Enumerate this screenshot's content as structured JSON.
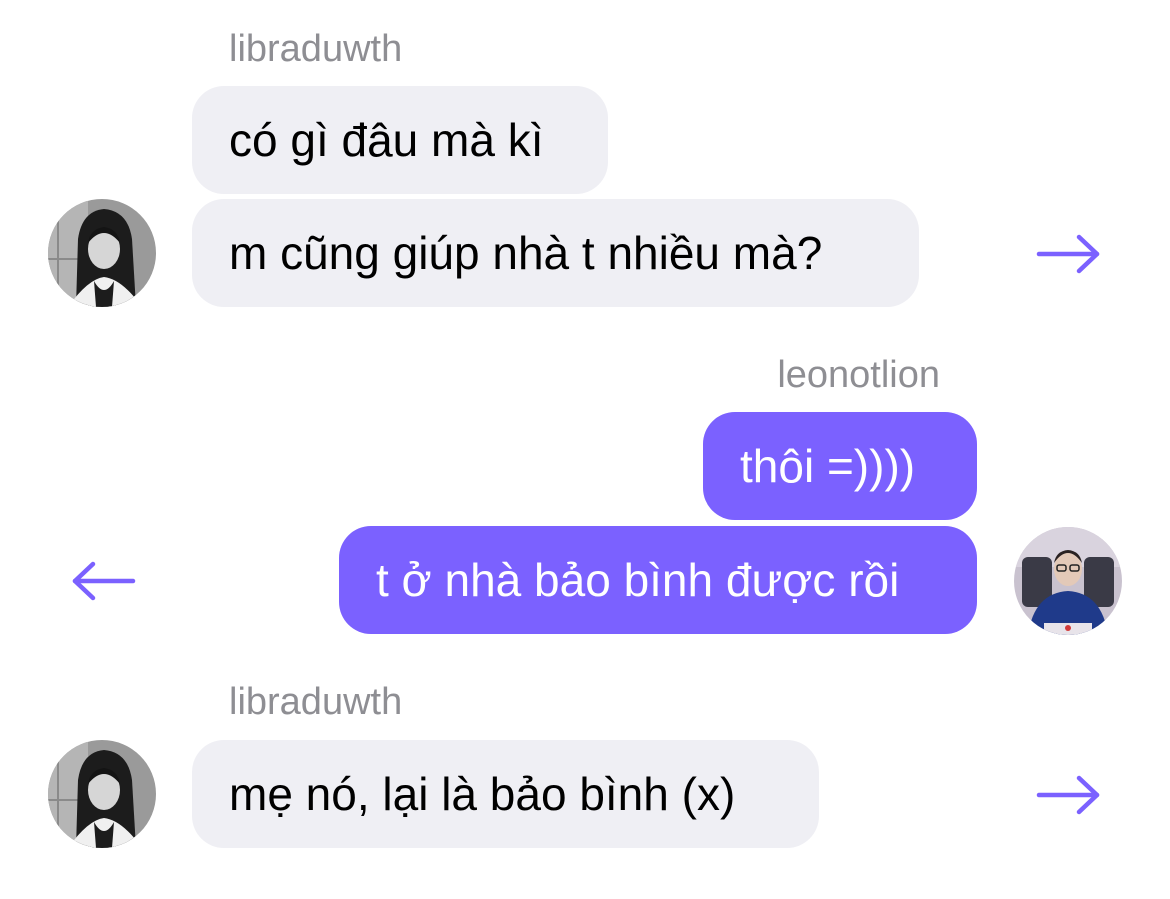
{
  "colors": {
    "incoming_bubble": "#efeff4",
    "outgoing_bubble": "#7b61ff",
    "sender_name": "#8e8e93",
    "action_arrow": "#7b61ff"
  },
  "messages": [
    {
      "sender": "libraduwth",
      "direction": "incoming",
      "lines": [
        "có gì đâu mà kì",
        "m cũng giúp nhà t nhiều mà?"
      ],
      "action_icon": "arrow-right-icon"
    },
    {
      "sender": "leonotlion",
      "direction": "outgoing",
      "lines": [
        "thôi =))))",
        "t ở nhà bảo bình được rồi"
      ],
      "action_icon": "arrow-left-icon"
    },
    {
      "sender": "libraduwth",
      "direction": "incoming",
      "lines": [
        "mẹ nó, lại là bảo bình (x)"
      ],
      "action_icon": "arrow-right-icon"
    }
  ]
}
